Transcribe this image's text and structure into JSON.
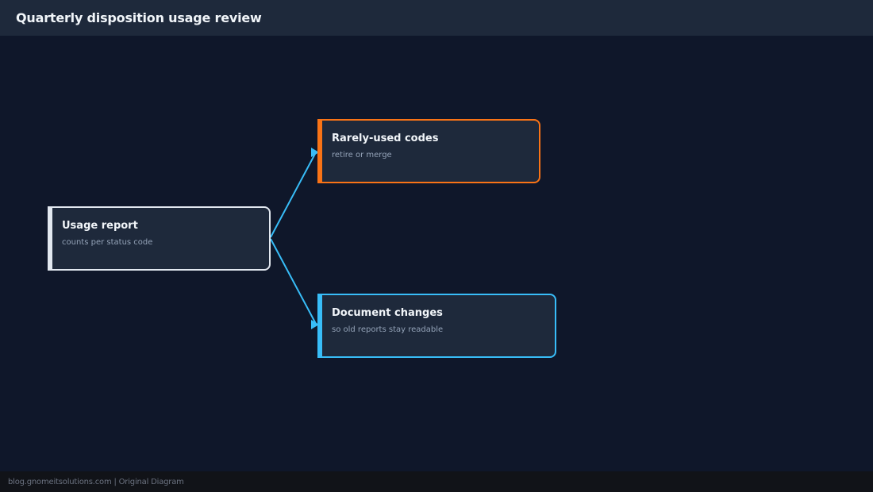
{
  "header": {
    "title": "Quarterly disposition usage review"
  },
  "nodes": {
    "usage_report": {
      "title": "Usage report",
      "subtitle": "counts per status code",
      "accent": "#e2e8f0"
    },
    "rarely_used": {
      "title": "Rarely-used codes",
      "subtitle": "retire or merge",
      "accent": "#f97316"
    },
    "document_changes": {
      "title": "Document changes",
      "subtitle": "so old reports stay readable",
      "accent": "#38bdf8"
    }
  },
  "edges": [
    {
      "from": "Usage report",
      "to": "Rarely-used codes"
    },
    {
      "from": "Usage report",
      "to": "Document changes"
    }
  ],
  "colors": {
    "background": "#0f172a",
    "panel": "#1e293b",
    "connector": "#38bdf8"
  },
  "footer": {
    "text": "blog.gnomeitsolutions.com | Original Diagram"
  }
}
